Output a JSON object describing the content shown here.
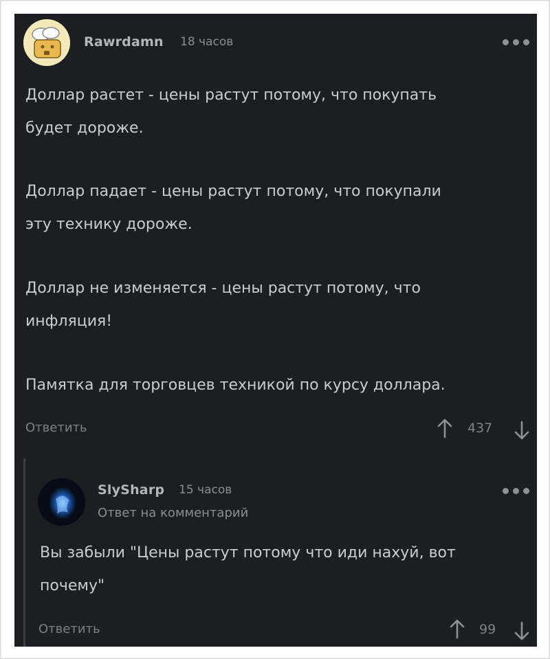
{
  "comment": {
    "username": "Rawrdamn",
    "time": "18 часов",
    "paragraphs": [
      "Доллар растет - цены растут потому, что покупать\nбудет дороже.",
      "Доллар падает - цены растут потому, что покупали\nэту технику дороже.",
      "Доллар не изменяется - цены растут потому, что\nинфляция!",
      "Памятка для торговцев техникой по курсу доллара."
    ],
    "reply_label": "Ответить",
    "rating": "437"
  },
  "reply": {
    "username": "SlySharp",
    "time": "15 часов",
    "reply_to": "Ответ на комментарий",
    "text": "Вы забыли \"Цены растут потому что иди нахуй, вот\nпочему\"",
    "reply_label": "Ответить",
    "rating": "99"
  },
  "icons": {
    "more": "more-dots-icon",
    "upvote": "arrow-up-icon",
    "downvote": "arrow-down-icon"
  }
}
